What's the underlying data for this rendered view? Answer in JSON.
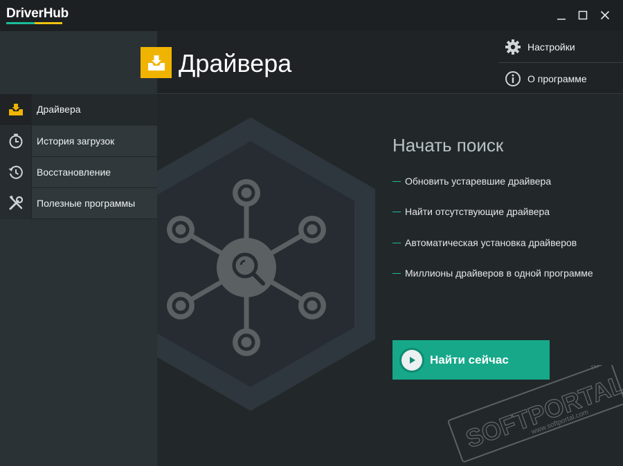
{
  "app": {
    "logo": "DriverHub",
    "colors": {
      "accent": "#1abc9c",
      "brand_yellow": "#f0b400",
      "button_green": "#16a889"
    },
    "window_controls": [
      "minimize-icon",
      "maximize-icon",
      "close-icon"
    ]
  },
  "sidebar": {
    "items": [
      {
        "label": "Драйвера",
        "icon": "driver-tray-icon",
        "active": true
      },
      {
        "label": "История загрузок",
        "icon": "clock-icon",
        "active": false
      },
      {
        "label": "Восстановление",
        "icon": "history-icon",
        "active": false
      },
      {
        "label": "Полезные программы",
        "icon": "tools-icon",
        "active": false
      }
    ]
  },
  "header": {
    "title": "Драйвера",
    "menu": [
      {
        "label": "Настройки",
        "icon": "gear-icon"
      },
      {
        "label": "О программе",
        "icon": "info-icon"
      }
    ]
  },
  "main": {
    "start_title": "Начать поиск",
    "features": [
      "Обновить устаревшие драйвера",
      "Найти отсутствующие драйвера",
      "Автоматическая установка драйверов",
      "Миллионы драйверов в одной программе"
    ],
    "find_button": "Найти сейчас"
  },
  "watermark": {
    "brand": "SOFTPORTAL",
    "url": "www.softportal.com",
    "tm": "TM"
  }
}
